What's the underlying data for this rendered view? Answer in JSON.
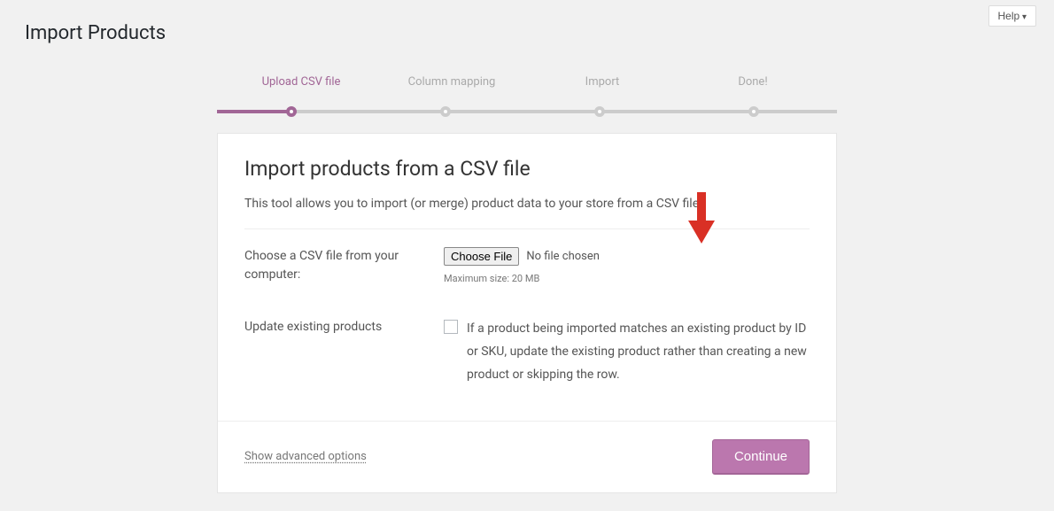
{
  "header": {
    "help_label": "Help",
    "page_title": "Import Products"
  },
  "steps": [
    {
      "label": "Upload CSV file",
      "active": true
    },
    {
      "label": "Column mapping",
      "active": false
    },
    {
      "label": "Import",
      "active": false
    },
    {
      "label": "Done!",
      "active": false
    }
  ],
  "panel": {
    "heading": "Import products from a CSV file",
    "description": "This tool allows you to import (or merge) product data to your store from a CSV file.",
    "choose_file": {
      "label": "Choose a CSV file from your computer:",
      "button": "Choose File",
      "no_file": "No file chosen",
      "hint": "Maximum size: 20 MB"
    },
    "update_existing": {
      "label": "Update existing products",
      "description": "If a product being imported matches an existing product by ID or SKU, update the existing product rather than creating a new product or skipping the row."
    },
    "footer": {
      "advanced_link": "Show advanced options",
      "continue": "Continue"
    }
  },
  "annotation": {
    "arrow_color": "#d93025"
  }
}
